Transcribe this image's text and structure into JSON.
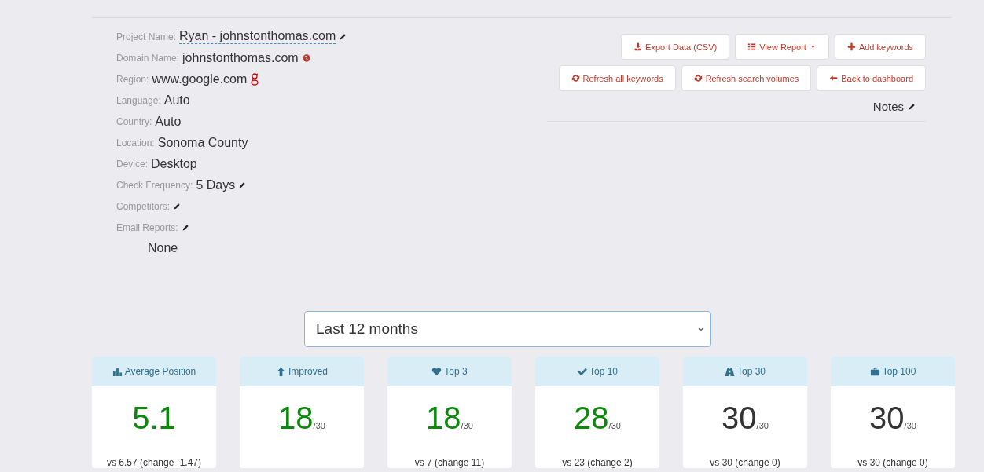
{
  "project_info": [
    {
      "label": "Project Name:",
      "value": "Ryan - johnstonthomas.com"
    },
    {
      "label": "Domain Name:",
      "value": "johnstonthomas.com"
    },
    {
      "label": "Region:",
      "value": "www.google.com"
    },
    {
      "label": "Language:",
      "value": "Auto"
    },
    {
      "label": "Country:",
      "value": "Auto"
    },
    {
      "label": "Location:",
      "value": "Sonoma County"
    },
    {
      "label": "Device:",
      "value": "Desktop"
    },
    {
      "label": "Check Frequency:",
      "value": "5 Days"
    },
    {
      "label": "Competitors:"
    },
    {
      "label": "Email Reports:",
      "value_below": "None"
    }
  ],
  "action_rows": [
    [
      {
        "label": "Export Data (CSV)",
        "dropdown": false
      },
      {
        "label": "View Report",
        "dropdown": true
      },
      {
        "label": "Add keywords",
        "dropdown": false
      }
    ],
    [
      {
        "label": "Refresh all keywords",
        "dropdown": false
      },
      {
        "label": "Refresh search volumes",
        "dropdown": false
      },
      {
        "label": "Back to dashboard",
        "dropdown": false
      }
    ]
  ],
  "notes": {
    "label": "Notes"
  },
  "period_select": {
    "value": "Last 12 months"
  },
  "stat_cards": [
    {
      "title": "Average Position",
      "value": "5.1",
      "highlighted": true,
      "comparison": "vs 6.57 (change -1.47)"
    },
    {
      "title": "Improved",
      "value": "18",
      "total": "/30",
      "highlighted": true
    },
    {
      "title": "Top 3",
      "value": "18",
      "total": "/30",
      "highlighted": true,
      "comparison": "vs 7 (change 11)"
    },
    {
      "title": "Top 10",
      "value": "28",
      "total": "/30",
      "highlighted": true,
      "comparison": "vs 23 (change 2)"
    },
    {
      "title": "Top 30",
      "value": "30",
      "total": "/30",
      "highlighted": false,
      "comparison": "vs 30 (change 0)"
    },
    {
      "title": "Top 100",
      "value": "30",
      "total": "/30",
      "highlighted": false,
      "comparison": "vs 30 (change 0)"
    }
  ]
}
